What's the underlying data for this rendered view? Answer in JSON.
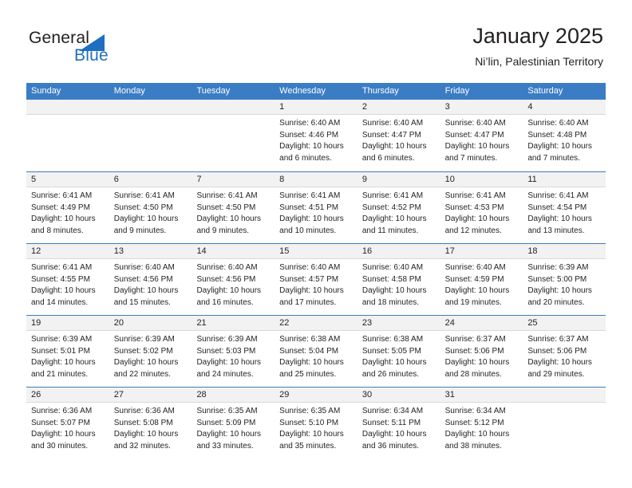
{
  "brand": {
    "name_part1": "General",
    "name_part2": "Blue",
    "triangle_icon": "triangle-icon",
    "accent_color": "#1f6fc0"
  },
  "header": {
    "title": "January 2025",
    "subtitle": "Ni’lin, Palestinian Territory"
  },
  "theme": {
    "header_row_bg": "#3b7dc4",
    "day_band_bg": "#f2f2f2",
    "text_color": "#231f20",
    "grid_line": "#3b7dc4"
  },
  "weekdays": [
    "Sunday",
    "Monday",
    "Tuesday",
    "Wednesday",
    "Thursday",
    "Friday",
    "Saturday"
  ],
  "weeks": [
    [
      {
        "day": "",
        "lines": []
      },
      {
        "day": "",
        "lines": []
      },
      {
        "day": "",
        "lines": []
      },
      {
        "day": "1",
        "lines": [
          "Sunrise: 6:40 AM",
          "Sunset: 4:46 PM",
          "Daylight: 10 hours",
          "and 6 minutes."
        ]
      },
      {
        "day": "2",
        "lines": [
          "Sunrise: 6:40 AM",
          "Sunset: 4:47 PM",
          "Daylight: 10 hours",
          "and 6 minutes."
        ]
      },
      {
        "day": "3",
        "lines": [
          "Sunrise: 6:40 AM",
          "Sunset: 4:47 PM",
          "Daylight: 10 hours",
          "and 7 minutes."
        ]
      },
      {
        "day": "4",
        "lines": [
          "Sunrise: 6:40 AM",
          "Sunset: 4:48 PM",
          "Daylight: 10 hours",
          "and 7 minutes."
        ]
      }
    ],
    [
      {
        "day": "5",
        "lines": [
          "Sunrise: 6:41 AM",
          "Sunset: 4:49 PM",
          "Daylight: 10 hours",
          "and 8 minutes."
        ]
      },
      {
        "day": "6",
        "lines": [
          "Sunrise: 6:41 AM",
          "Sunset: 4:50 PM",
          "Daylight: 10 hours",
          "and 9 minutes."
        ]
      },
      {
        "day": "7",
        "lines": [
          "Sunrise: 6:41 AM",
          "Sunset: 4:50 PM",
          "Daylight: 10 hours",
          "and 9 minutes."
        ]
      },
      {
        "day": "8",
        "lines": [
          "Sunrise: 6:41 AM",
          "Sunset: 4:51 PM",
          "Daylight: 10 hours",
          "and 10 minutes."
        ]
      },
      {
        "day": "9",
        "lines": [
          "Sunrise: 6:41 AM",
          "Sunset: 4:52 PM",
          "Daylight: 10 hours",
          "and 11 minutes."
        ]
      },
      {
        "day": "10",
        "lines": [
          "Sunrise: 6:41 AM",
          "Sunset: 4:53 PM",
          "Daylight: 10 hours",
          "and 12 minutes."
        ]
      },
      {
        "day": "11",
        "lines": [
          "Sunrise: 6:41 AM",
          "Sunset: 4:54 PM",
          "Daylight: 10 hours",
          "and 13 minutes."
        ]
      }
    ],
    [
      {
        "day": "12",
        "lines": [
          "Sunrise: 6:41 AM",
          "Sunset: 4:55 PM",
          "Daylight: 10 hours",
          "and 14 minutes."
        ]
      },
      {
        "day": "13",
        "lines": [
          "Sunrise: 6:40 AM",
          "Sunset: 4:56 PM",
          "Daylight: 10 hours",
          "and 15 minutes."
        ]
      },
      {
        "day": "14",
        "lines": [
          "Sunrise: 6:40 AM",
          "Sunset: 4:56 PM",
          "Daylight: 10 hours",
          "and 16 minutes."
        ]
      },
      {
        "day": "15",
        "lines": [
          "Sunrise: 6:40 AM",
          "Sunset: 4:57 PM",
          "Daylight: 10 hours",
          "and 17 minutes."
        ]
      },
      {
        "day": "16",
        "lines": [
          "Sunrise: 6:40 AM",
          "Sunset: 4:58 PM",
          "Daylight: 10 hours",
          "and 18 minutes."
        ]
      },
      {
        "day": "17",
        "lines": [
          "Sunrise: 6:40 AM",
          "Sunset: 4:59 PM",
          "Daylight: 10 hours",
          "and 19 minutes."
        ]
      },
      {
        "day": "18",
        "lines": [
          "Sunrise: 6:39 AM",
          "Sunset: 5:00 PM",
          "Daylight: 10 hours",
          "and 20 minutes."
        ]
      }
    ],
    [
      {
        "day": "19",
        "lines": [
          "Sunrise: 6:39 AM",
          "Sunset: 5:01 PM",
          "Daylight: 10 hours",
          "and 21 minutes."
        ]
      },
      {
        "day": "20",
        "lines": [
          "Sunrise: 6:39 AM",
          "Sunset: 5:02 PM",
          "Daylight: 10 hours",
          "and 22 minutes."
        ]
      },
      {
        "day": "21",
        "lines": [
          "Sunrise: 6:39 AM",
          "Sunset: 5:03 PM",
          "Daylight: 10 hours",
          "and 24 minutes."
        ]
      },
      {
        "day": "22",
        "lines": [
          "Sunrise: 6:38 AM",
          "Sunset: 5:04 PM",
          "Daylight: 10 hours",
          "and 25 minutes."
        ]
      },
      {
        "day": "23",
        "lines": [
          "Sunrise: 6:38 AM",
          "Sunset: 5:05 PM",
          "Daylight: 10 hours",
          "and 26 minutes."
        ]
      },
      {
        "day": "24",
        "lines": [
          "Sunrise: 6:37 AM",
          "Sunset: 5:06 PM",
          "Daylight: 10 hours",
          "and 28 minutes."
        ]
      },
      {
        "day": "25",
        "lines": [
          "Sunrise: 6:37 AM",
          "Sunset: 5:06 PM",
          "Daylight: 10 hours",
          "and 29 minutes."
        ]
      }
    ],
    [
      {
        "day": "26",
        "lines": [
          "Sunrise: 6:36 AM",
          "Sunset: 5:07 PM",
          "Daylight: 10 hours",
          "and 30 minutes."
        ]
      },
      {
        "day": "27",
        "lines": [
          "Sunrise: 6:36 AM",
          "Sunset: 5:08 PM",
          "Daylight: 10 hours",
          "and 32 minutes."
        ]
      },
      {
        "day": "28",
        "lines": [
          "Sunrise: 6:35 AM",
          "Sunset: 5:09 PM",
          "Daylight: 10 hours",
          "and 33 minutes."
        ]
      },
      {
        "day": "29",
        "lines": [
          "Sunrise: 6:35 AM",
          "Sunset: 5:10 PM",
          "Daylight: 10 hours",
          "and 35 minutes."
        ]
      },
      {
        "day": "30",
        "lines": [
          "Sunrise: 6:34 AM",
          "Sunset: 5:11 PM",
          "Daylight: 10 hours",
          "and 36 minutes."
        ]
      },
      {
        "day": "31",
        "lines": [
          "Sunrise: 6:34 AM",
          "Sunset: 5:12 PM",
          "Daylight: 10 hours",
          "and 38 minutes."
        ]
      },
      {
        "day": "",
        "lines": []
      }
    ]
  ]
}
